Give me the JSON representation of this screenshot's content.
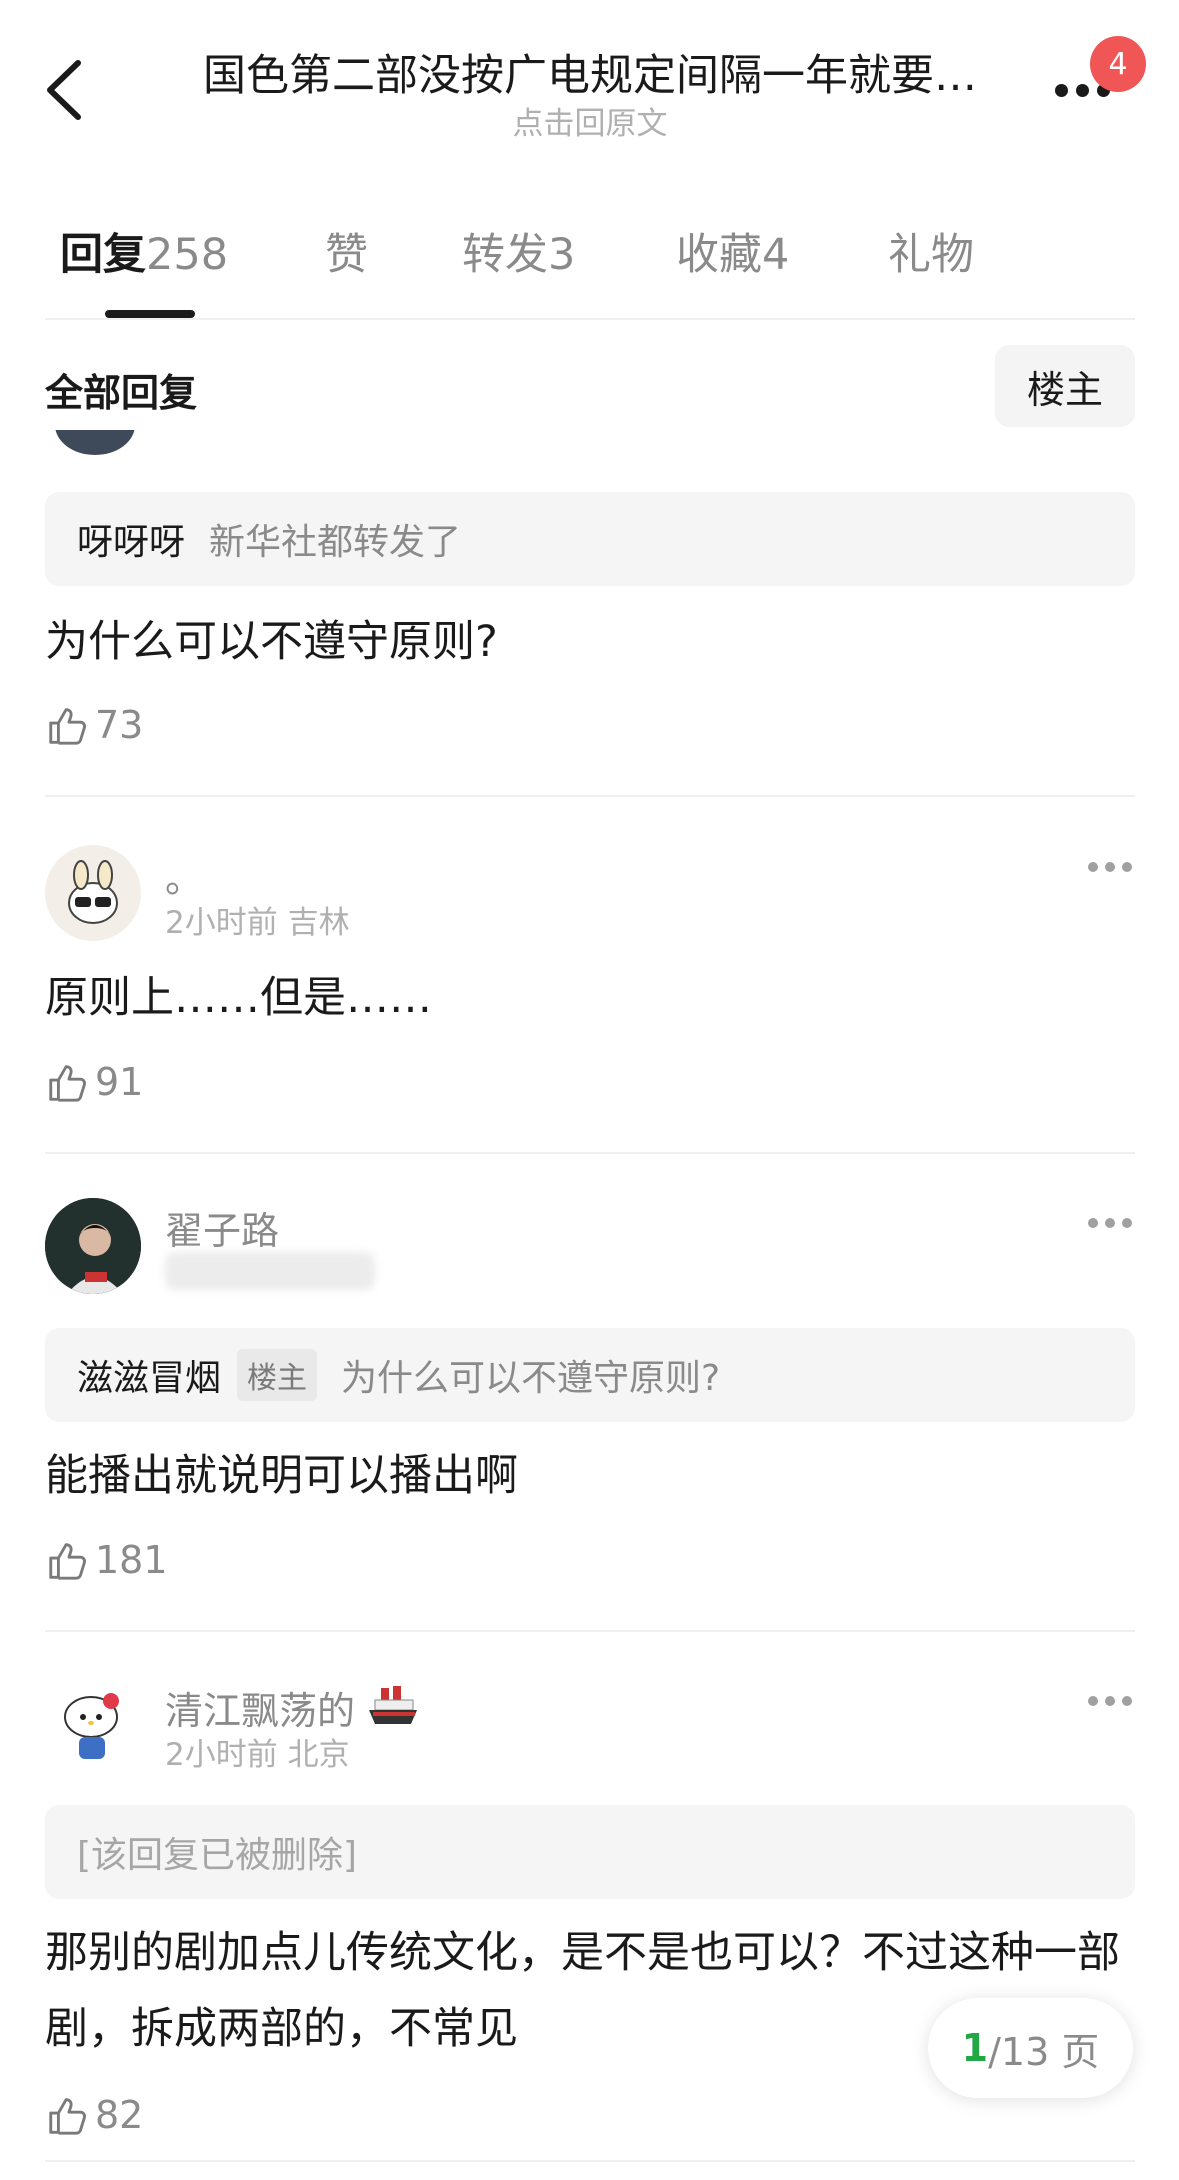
{
  "header": {
    "title": "国色第二部没按广电规定间隔一年就要…",
    "subtitle": "点击回原文",
    "badge": "4"
  },
  "tabs": [
    {
      "label": "回复",
      "count": "258",
      "active": true
    },
    {
      "label": "赞",
      "count": ""
    },
    {
      "label": "转发",
      "count": "3"
    },
    {
      "label": "收藏",
      "count": "4"
    },
    {
      "label": "礼物",
      "count": ""
    }
  ],
  "filter": {
    "label": "全部回复",
    "op_button": "楼主"
  },
  "comments": [
    {
      "quote_author": "呀呀呀",
      "quote_text": "新华社都转发了",
      "content": "为什么可以不遵守原则?",
      "likes": "73"
    },
    {
      "username": "。",
      "meta": "2小时前 吉林",
      "content": "原则上……但是……",
      "likes": "91"
    },
    {
      "username": "翟子路",
      "quote_author": "滋滋冒烟",
      "quote_tag": "楼主",
      "quote_text": "为什么可以不遵守原则?",
      "content": "能播出就说明可以播出啊",
      "likes": "181"
    },
    {
      "username": "清江飘荡的",
      "meta": "2小时前 北京",
      "quote_deleted": "[该回复已被删除]",
      "content": "那别的剧加点儿传统文化，是不是也可以？不过这种一部剧，拆成两部的，不常见",
      "likes": "82"
    }
  ],
  "pager": {
    "current": "1",
    "total": "/13 页"
  },
  "colors": {
    "accent_green": "#21a744",
    "badge_red": "#f05656"
  }
}
